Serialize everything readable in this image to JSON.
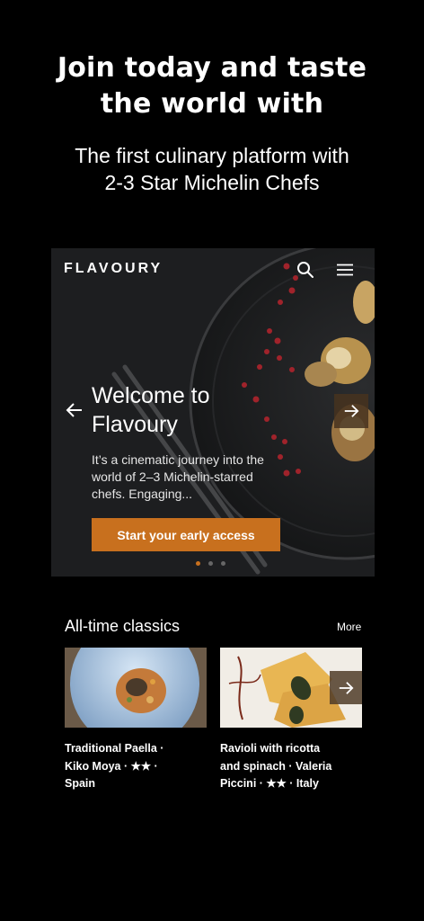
{
  "headline": {
    "line1": "Join today and taste",
    "line2": "the world with"
  },
  "subhead": {
    "line1": "The first culinary platform with",
    "line2": "2-3 Star Michelin Chefs"
  },
  "hero": {
    "brand": "FLAVOURY",
    "title_line1": "Welcome to",
    "title_line2": "Flavoury",
    "body": "It’s a cinematic journey into the world of 2–3 Michelin-starred chefs. Engaging...",
    "cta_label": "Start your early access",
    "slides": {
      "total": 3,
      "active": 1
    }
  },
  "section": {
    "title": "All-time classics",
    "more_label": "More"
  },
  "cards": [
    {
      "line1": "Traditional Paella ·",
      "line2": "Kiko Moya · ★★ ·",
      "line3": "Spain"
    },
    {
      "line1": "Ravioli with ricotta",
      "line2": "and spinach · Valeria",
      "line3": "Piccini · ★★ · Italy"
    }
  ],
  "icons": {
    "search": "search-icon",
    "menu": "menu-icon",
    "prev": "arrow-left-icon",
    "next": "arrow-right-icon"
  },
  "colors": {
    "background": "#000000",
    "accent": "#c8701e",
    "text": "#ffffff"
  }
}
